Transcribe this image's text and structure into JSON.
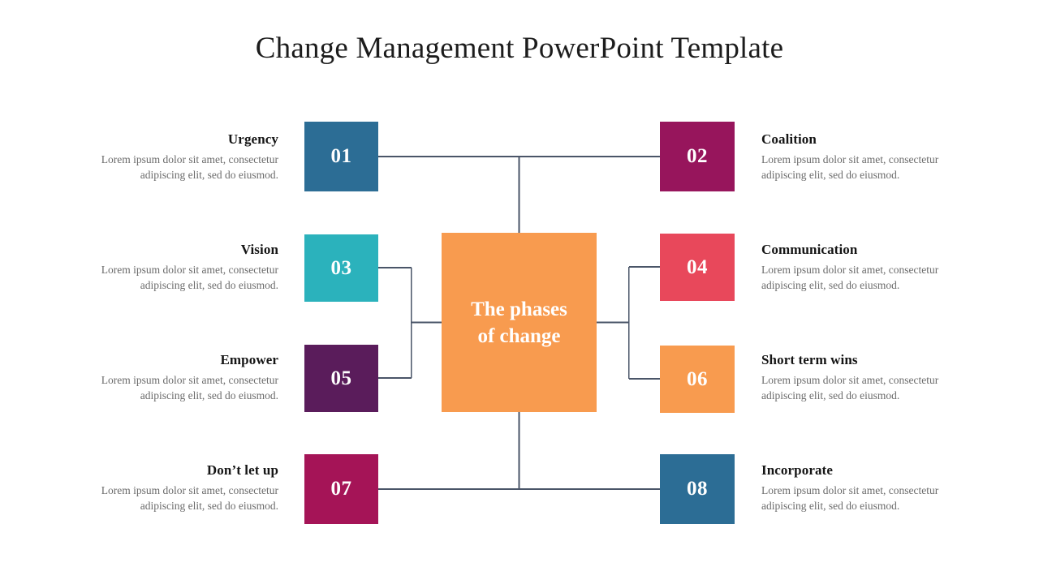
{
  "slide": {
    "title": "Change Management PowerPoint Template",
    "background": "#ffffff"
  },
  "center": {
    "label": "The phases of change",
    "line1": "The phases",
    "line2": "of change",
    "color": "#F89B4F"
  },
  "connector": {
    "color": "#4a5568",
    "width": 1.6
  },
  "phases": [
    {
      "number": "01",
      "heading": "Urgency",
      "description": "Lorem ipsum dolor sit amet, consectetur adipiscing elit, sed do eiusmod.",
      "color": "#2C6D95",
      "side": "left"
    },
    {
      "number": "02",
      "heading": "Coalition",
      "description": "Lorem ipsum dolor sit amet, consectetur adipiscing elit, sed do eiusmod.",
      "color": "#97155C",
      "side": "right"
    },
    {
      "number": "03",
      "heading": "Vision",
      "description": "Lorem ipsum dolor sit amet, consectetur adipiscing elit, sed do eiusmod.",
      "color": "#2BB2BC",
      "side": "left"
    },
    {
      "number": "04",
      "heading": "Communication",
      "description": "Lorem ipsum dolor sit amet, consectetur adipiscing elit, sed do eiusmod.",
      "color": "#E8485B",
      "side": "right"
    },
    {
      "number": "05",
      "heading": "Empower",
      "description": "Lorem ipsum dolor sit amet, consectetur adipiscing elit, sed do eiusmod.",
      "color": "#5A1C5B",
      "side": "left"
    },
    {
      "number": "06",
      "heading": "Short term wins",
      "description": "Lorem ipsum dolor sit amet, consectetur adipiscing elit, sed do eiusmod.",
      "color": "#F89B4F",
      "side": "right"
    },
    {
      "number": "07",
      "heading": "Don’t let up",
      "description": "Lorem ipsum dolor sit amet, consectetur adipiscing elit, sed do eiusmod.",
      "color": "#A51457",
      "side": "left"
    },
    {
      "number": "08",
      "heading": "Incorporate",
      "description": "Lorem ipsum dolor sit amet, consectetur adipiscing elit, sed do eiusmod.",
      "color": "#2C6D95",
      "side": "right"
    }
  ]
}
